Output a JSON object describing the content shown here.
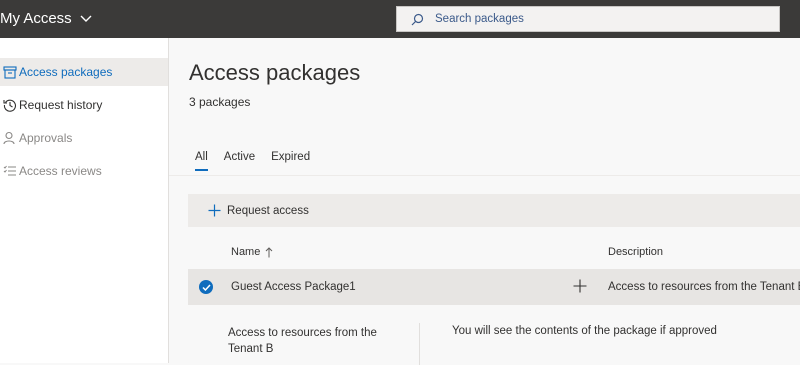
{
  "header": {
    "app_title": "My Access",
    "search": {
      "placeholder": "Search packages",
      "value": ""
    }
  },
  "sidebar": {
    "items": [
      {
        "label": "Access packages",
        "icon": "package-icon",
        "state": "active"
      },
      {
        "label": "Request history",
        "icon": "history-icon",
        "state": "normal"
      },
      {
        "label": "Approvals",
        "icon": "person-icon",
        "state": "muted"
      },
      {
        "label": "Access reviews",
        "icon": "checklist-icon",
        "state": "muted"
      }
    ]
  },
  "main": {
    "title": "Access packages",
    "count": "3 packages",
    "tabs": [
      {
        "label": "All",
        "active": true
      },
      {
        "label": "Active",
        "active": false
      },
      {
        "label": "Expired",
        "active": false
      }
    ],
    "toolbar": {
      "request_access_label": "Request access"
    },
    "table": {
      "columns": [
        {
          "label": "Name",
          "sort": "ascending"
        },
        {
          "label": "Description"
        }
      ],
      "rows": [
        {
          "selected": true,
          "name": "Guest Access Package1",
          "description": "Access to resources from the Tenant B"
        }
      ]
    },
    "details": {
      "description": "Access to resources from the Tenant B",
      "note": "You will see the contents of the package if approved"
    }
  },
  "colors": {
    "accent": "#0f6cbd",
    "topbar": "#3b3a39"
  }
}
